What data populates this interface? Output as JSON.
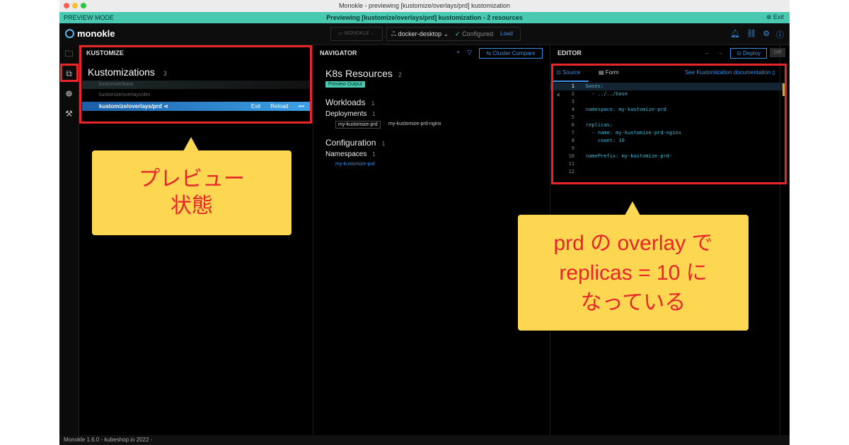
{
  "window": {
    "title": "Monokle - previewing [kustomize/overlays/prd] kustomization"
  },
  "preview_bar": {
    "mode_label": "PREVIEW MODE",
    "message": "Previewing [kustomize/overlays/prd] kustomization - 2 resources",
    "exit_label": "Exit"
  },
  "topbar": {
    "logo": "monokle",
    "project_label": "MONOKLE",
    "context": "docker-desktop",
    "config_status": "Configured",
    "load_label": "Load"
  },
  "kustomize_panel": {
    "header": "KUSTOMIZE",
    "title": "Kustomizations",
    "count": "3",
    "items": [
      {
        "label": "kustomize/base"
      },
      {
        "label": "kustomize/overlays/dev"
      },
      {
        "label": "kustomize/overlays/prd",
        "exit": "Exit",
        "reload": "Reload",
        "more": "•••"
      }
    ]
  },
  "navigator": {
    "header": "NAVIGATOR",
    "cluster_compare": "Cluster Compare",
    "title": "K8s Resources",
    "count": "2",
    "preview_badge": "Preview Output",
    "workloads": {
      "label": "Workloads",
      "count": "1"
    },
    "deployments": {
      "label": "Deployments",
      "count": "1"
    },
    "deployment_chip": "my-kustomize-prd",
    "deployment_suffix": "my-kustomize-prd-nginx",
    "configuration": {
      "label": "Configuration",
      "count": "1"
    },
    "namespaces": {
      "label": "Namespaces",
      "count": "1"
    },
    "namespace_item": "my-kustomize-prd"
  },
  "editor": {
    "header": "EDITOR",
    "deploy": "Deploy",
    "diff": "Diff",
    "tab_source": "Source",
    "tab_form": "Form",
    "doc_link": "See Kustomization documentation",
    "lines": [
      {
        "n": "1",
        "text": "bases:"
      },
      {
        "n": "2",
        "text": "  - ../../base"
      },
      {
        "n": "3",
        "text": ""
      },
      {
        "n": "4",
        "text": "namespace: my-kustomize-prd"
      },
      {
        "n": "5",
        "text": ""
      },
      {
        "n": "6",
        "text": "replicas:"
      },
      {
        "n": "7",
        "text": "  - name: my-kustomize-prd-nginx"
      },
      {
        "n": "8",
        "text": "    count: 10"
      },
      {
        "n": "9",
        "text": ""
      },
      {
        "n": "10",
        "text": "namePrefix: my-kustomize-prd-"
      },
      {
        "n": "11",
        "text": ""
      },
      {
        "n": "12",
        "text": ""
      }
    ]
  },
  "statusbar": {
    "text": "Monokle 1.6.0 - kubeshop.io 2022 -"
  },
  "annotations": {
    "left_callout_line1": "プレビュー",
    "left_callout_line2": "状態",
    "right_callout_line1": "prd の overlay で",
    "right_callout_line2": "replicas = 10 に",
    "right_callout_line3": "なっている"
  },
  "colors": {
    "accent": "#3c8ee0",
    "preview": "#48c9b0",
    "annotation_red": "#e8262a",
    "callout_yellow": "#fdd752"
  }
}
